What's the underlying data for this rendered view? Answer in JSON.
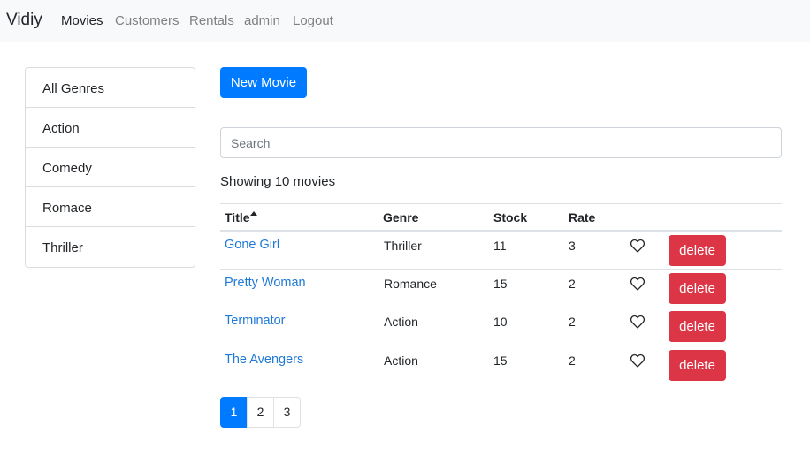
{
  "navbar": {
    "brand": "Vidiy",
    "links": [
      "Movies",
      "Customers",
      "Rentals",
      "admin",
      "Logout"
    ]
  },
  "genres": [
    "All Genres",
    "Action",
    "Comedy",
    "Romace",
    "Thriller"
  ],
  "new_movie_label": "New Movie",
  "search": {
    "placeholder": "Search",
    "value": ""
  },
  "showing_text": "Showing 10 movies",
  "table": {
    "headers": [
      "Title",
      "Genre",
      "Stock",
      "Rate"
    ],
    "rows": [
      {
        "title": "Gone Girl",
        "genre": "Thriller",
        "stock": "11",
        "rate": "3",
        "delete_label": "delete"
      },
      {
        "title": "Pretty Woman",
        "genre": "Romance",
        "stock": "15",
        "rate": "2",
        "delete_label": "delete"
      },
      {
        "title": "Terminator",
        "genre": "Action",
        "stock": "10",
        "rate": "2",
        "delete_label": "delete"
      },
      {
        "title": "The Avengers",
        "genre": "Action",
        "stock": "15",
        "rate": "2",
        "delete_label": "delete"
      }
    ]
  },
  "pagination": [
    "1",
    "2",
    "3"
  ],
  "colors": {
    "primary": "#007bff",
    "danger": "#dc3545",
    "link": "#1f7ad8",
    "navbar_bg": "#f8f9fa"
  },
  "icons": {
    "like": "heart-outline-icon",
    "sort": "caret-up-icon"
  }
}
